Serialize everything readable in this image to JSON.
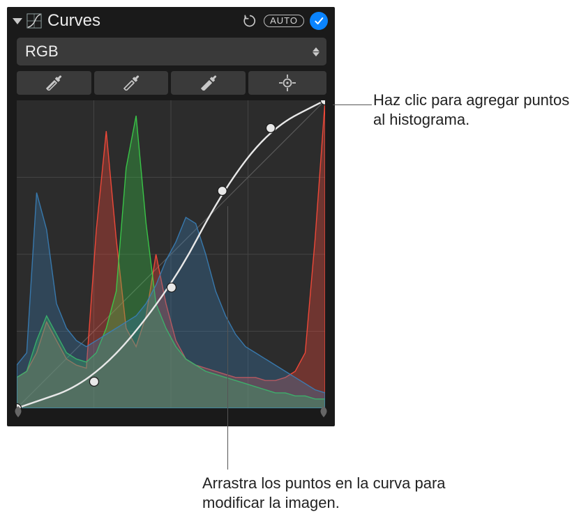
{
  "panel": {
    "title": "Curves",
    "auto_label": "AUTO"
  },
  "channel": {
    "selected": "RGB"
  },
  "tools": {
    "black_dropper": "black-point-eyedropper",
    "gray_dropper": "gray-point-eyedropper",
    "white_dropper": "white-point-eyedropper",
    "add_point": "add-point"
  },
  "callouts": {
    "add_point": "Haz clic para agregar puntos al histograma.",
    "drag_point": "Arrastra los puntos en la curva para modificar la imagen."
  },
  "colors": {
    "accent": "#0a84ff",
    "red": "#ff4a3a",
    "green": "#3bd24a",
    "blue": "#3a7fb8"
  },
  "chart_data": {
    "type": "area",
    "xrange": [
      0,
      255
    ],
    "yrange": [
      0,
      1
    ],
    "grid": {
      "vdivisions": 4,
      "hdivisions": 4
    },
    "curve_points": [
      {
        "x": 0,
        "y": 0,
        "handle": true
      },
      {
        "x": 64,
        "y": 22,
        "handle": true
      },
      {
        "x": 128,
        "y": 100,
        "handle": true
      },
      {
        "x": 170,
        "y": 180,
        "handle": true
      },
      {
        "x": 210,
        "y": 232,
        "handle": true
      },
      {
        "x": 255,
        "y": 255,
        "handle": true
      }
    ],
    "series": [
      {
        "name": "red",
        "color": "#ff4a3a",
        "values": [
          0.1,
          0.12,
          0.18,
          0.28,
          0.22,
          0.16,
          0.14,
          0.13,
          0.58,
          0.9,
          0.55,
          0.26,
          0.2,
          0.3,
          0.5,
          0.34,
          0.22,
          0.16,
          0.14,
          0.13,
          0.12,
          0.11,
          0.1,
          0.1,
          0.1,
          0.09,
          0.09,
          0.1,
          0.12,
          0.18,
          0.55,
          1.0
        ]
      },
      {
        "name": "green",
        "color": "#3bd24a",
        "values": [
          0.1,
          0.12,
          0.22,
          0.3,
          0.24,
          0.18,
          0.16,
          0.15,
          0.18,
          0.26,
          0.38,
          0.78,
          0.95,
          0.6,
          0.34,
          0.26,
          0.2,
          0.16,
          0.14,
          0.12,
          0.11,
          0.1,
          0.09,
          0.08,
          0.07,
          0.06,
          0.05,
          0.05,
          0.04,
          0.04,
          0.03,
          0.03
        ]
      },
      {
        "name": "blue",
        "color": "#3a7fb8",
        "values": [
          0.14,
          0.18,
          0.7,
          0.58,
          0.34,
          0.26,
          0.22,
          0.2,
          0.22,
          0.24,
          0.26,
          0.28,
          0.3,
          0.34,
          0.4,
          0.48,
          0.54,
          0.62,
          0.6,
          0.5,
          0.38,
          0.3,
          0.24,
          0.2,
          0.18,
          0.16,
          0.14,
          0.12,
          0.1,
          0.08,
          0.06,
          0.05
        ]
      }
    ]
  }
}
